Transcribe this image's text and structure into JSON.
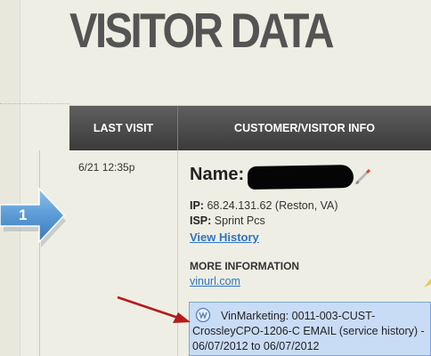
{
  "page": {
    "title": "VISITOR DATA"
  },
  "table": {
    "headers": {
      "last_visit": "LAST VISIT",
      "customer_info": "CUSTOMER/VISITOR INFO"
    },
    "row": {
      "number": "1",
      "visit_time": "6/21 12:35p",
      "name_label": "Name:",
      "ip_label": "IP:",
      "ip_value": "68.24.131.62 (Reston, VA)",
      "isp_label": "ISP:",
      "isp_value": "Sprint Pcs",
      "view_history_label": "View History",
      "more_info_label": "MORE INFORMATION",
      "more_info_link": "vinurl.com",
      "vinmarketing_text": "VinMarketing: 0011-003-CUST-CrossleyCPO-1206-C EMAIL (service history) - 06/07/2012 to 06/07/2012"
    }
  },
  "icons": [
    "row-arrow-icon",
    "edit-pencil-icon",
    "vinmarketing-icon",
    "annotation-arrow-icon"
  ],
  "colors": {
    "background": "#efeee4",
    "header_bg": "#4a4a4a",
    "link": "#2f74c4",
    "highlight_box": "#c9dcf6",
    "annotation_arrow": "#b31b1b",
    "row_arrow": "#5b9bd5"
  }
}
